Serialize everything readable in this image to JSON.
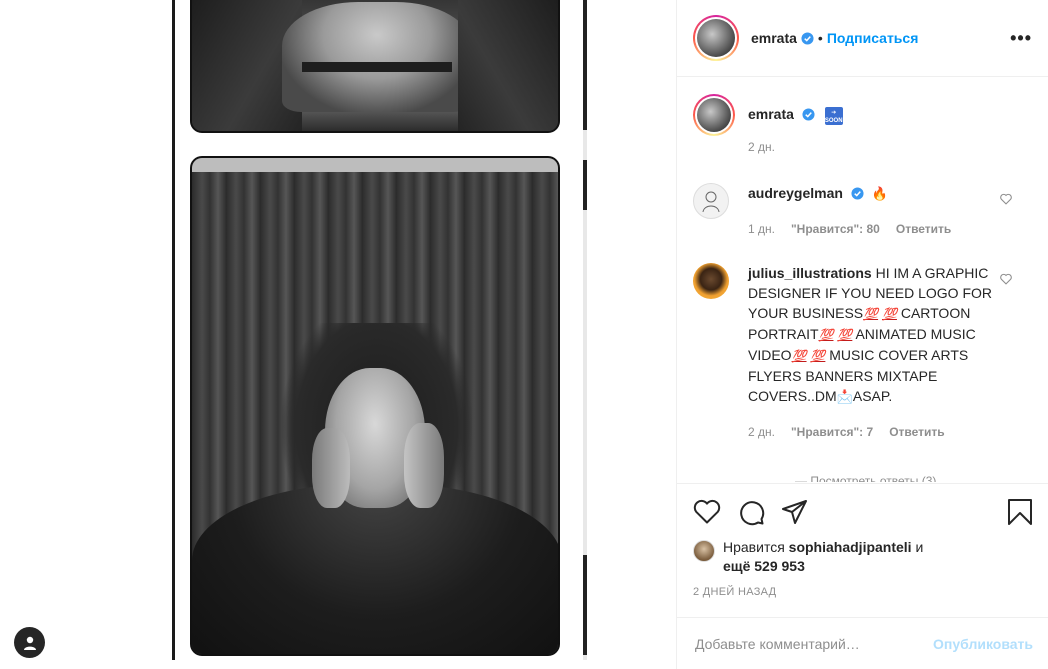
{
  "post": {
    "author": "emrata",
    "follow_label": "Подписаться",
    "more_label": "•••"
  },
  "caption": {
    "author": "emrata",
    "soon_icon_text": "SOON",
    "time": "2 дн."
  },
  "comments": [
    {
      "author": "audreygelman",
      "text": "🔥",
      "time": "1 дн.",
      "likes": "\"Нравится\": 80",
      "reply": "Ответить"
    },
    {
      "author": "julius_illustrations",
      "text_parts": [
        "HI IM A GRAPHIC DESIGNER IF YOU NEED LOGO FOR YOUR BUSINESS",
        "💯",
        "💯",
        " CARTOON PORTRAIT",
        "💯",
        "💯",
        " ANIMATED MUSIC VIDEO",
        "💯",
        "💯",
        " MUSIC COVER ARTS FLYERS BANNERS MIXTAPE COVERS..DM",
        "📩",
        "ASAP."
      ],
      "time": "2 дн.",
      "likes": "\"Нравится\": 7",
      "reply": "Ответить"
    }
  ],
  "more_replies": "— Посмотреть ответы (3)",
  "likes": {
    "prefix": "Нравится",
    "user": "sophiahadjipanteli",
    "suffix": "и",
    "count_text": "ещё 529 953"
  },
  "date": "2 ДНЕЙ НАЗАД",
  "add_comment": {
    "placeholder": "Добавьте комментарий…",
    "publish": "Опубликовать"
  },
  "icons": {
    "verified": "verified-badge-icon",
    "heart": "heart-icon",
    "comment": "comment-icon",
    "share": "share-icon",
    "bookmark": "bookmark-icon",
    "user": "user-icon"
  },
  "colors": {
    "accent": "#0095f6",
    "publish_disabled": "#b2dffc",
    "muted": "#8e8e8e",
    "text": "#262626"
  }
}
